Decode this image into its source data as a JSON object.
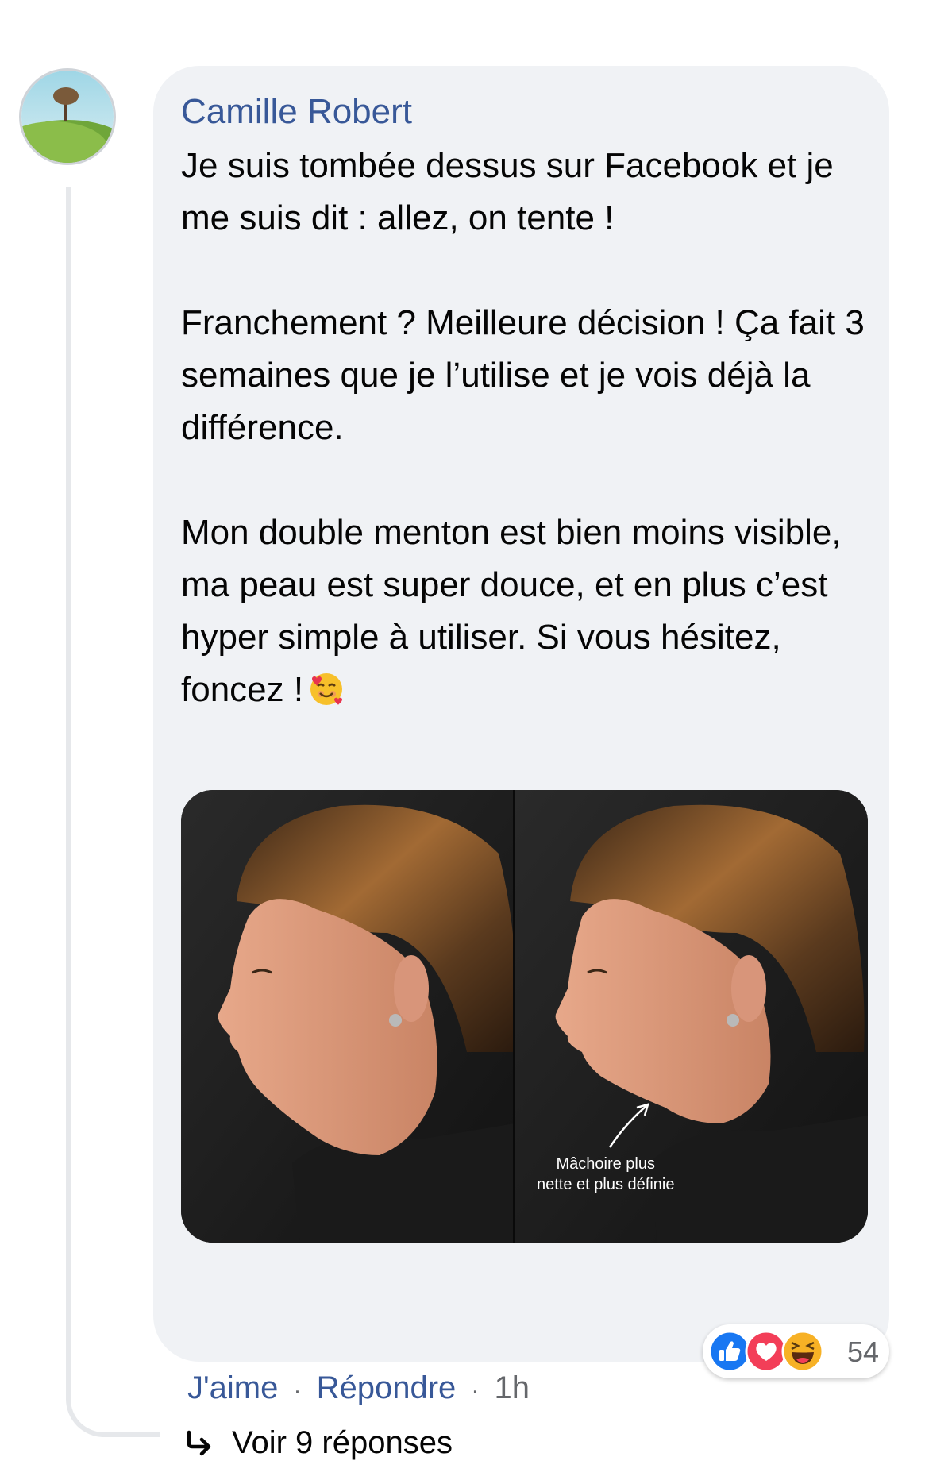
{
  "comment": {
    "author": "Camille Robert",
    "paragraphs": [
      "Je suis tombée dessus sur Facebook et je me suis dit : allez, on tente !",
      "Franchement ? Meilleure décision ! Ça fait 3 semaines que je l’utilise et je vois déjà la différence.",
      "Mon double menton est bien moins visible, ma peau est super douce, et en plus c’est hyper simple à utiliser. Si vous hésitez, foncez !"
    ],
    "emoji_icon": "smiling-face-with-hearts",
    "image": {
      "annotation_line1": "Mâchoire plus",
      "annotation_line2": "nette et plus définie"
    },
    "reactions": {
      "icons": [
        "like-icon",
        "love-icon",
        "haha-icon"
      ],
      "count": "54"
    },
    "actions": {
      "like": "J'aime",
      "reply": "Répondre",
      "separator": "·",
      "time": "1h"
    },
    "view_replies": "Voir 9 réponses"
  },
  "colors": {
    "author_link": "#385898",
    "bubble_bg": "#f0f2f5",
    "like_blue": "#1877f2",
    "love_red": "#f33e58",
    "haha_yellow": "#f7b125"
  }
}
